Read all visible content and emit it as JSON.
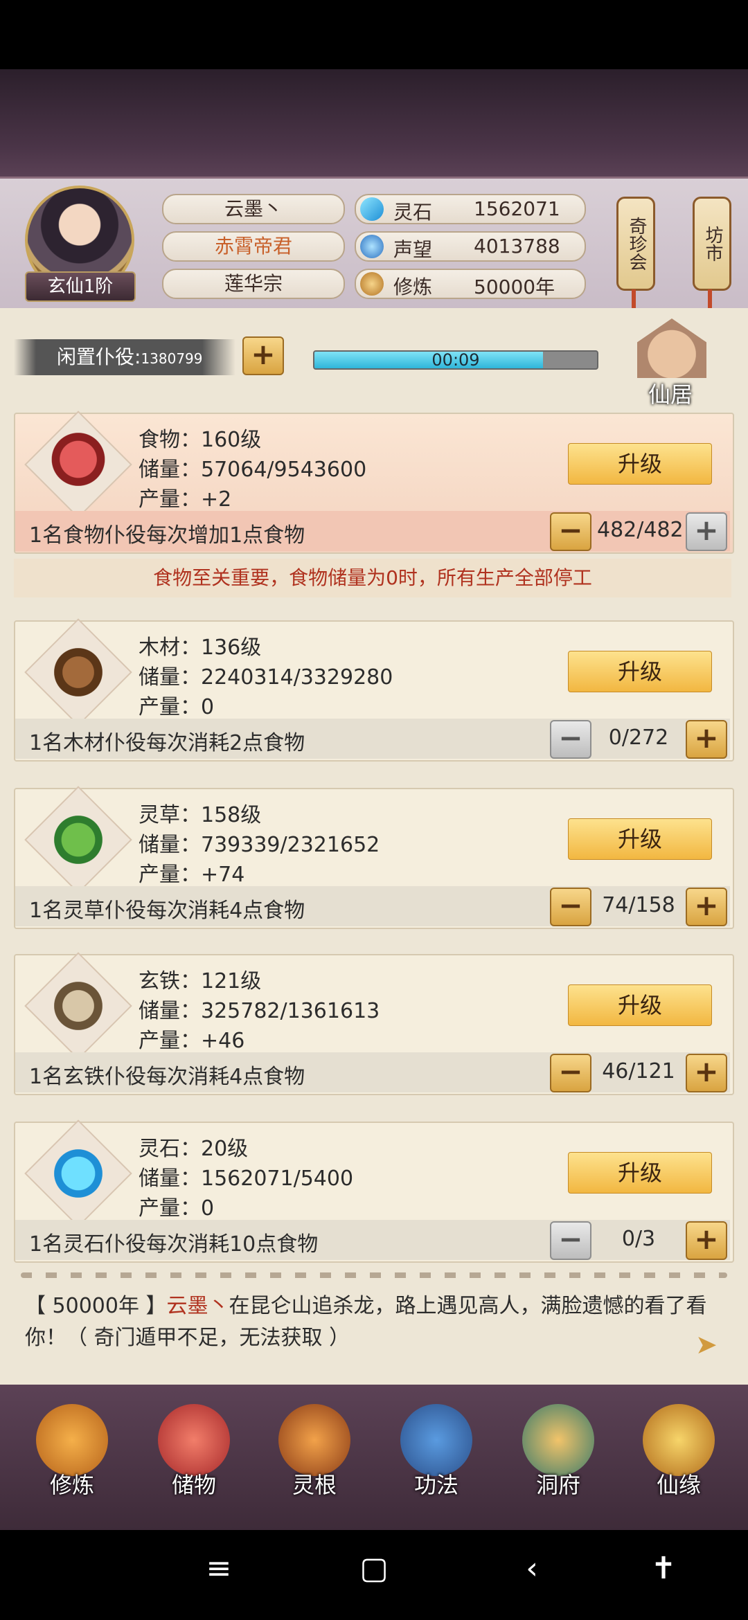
{
  "header": {
    "player_name": "云墨丶",
    "title": "赤霄帝君",
    "sect": "莲华宗",
    "rank": "玄仙1阶",
    "stats": [
      {
        "label": "灵石",
        "value": "1562071",
        "icon": "spirit-stone-icon",
        "color": "#34b7e8"
      },
      {
        "label": "声望",
        "value": "4013788",
        "icon": "reputation-icon",
        "color": "#3a8fd6"
      },
      {
        "label": "修炼",
        "value": "50000年",
        "icon": "cultivation-icon",
        "color": "#c28a2e"
      }
    ],
    "lanterns": [
      "奇珍会",
      "坊市"
    ]
  },
  "servants": {
    "label": "闲置仆役:",
    "count": "1380799",
    "timer": "00:09",
    "timer_progress": 0.81,
    "building_label": "仙居"
  },
  "resources": [
    {
      "name": "食物",
      "level": "食物：160级",
      "storage": "储量：57064/9543600",
      "output": "产量：+2",
      "note": "1名食物仆役每次增加1点食物",
      "assigned": "482/482",
      "upgrade": "升级",
      "highlight": true
    },
    {
      "name": "木材",
      "level": "木材：136级",
      "storage": "储量：2240314/3329280",
      "output": "产量：0",
      "note": "1名木材仆役每次消耗2点食物",
      "assigned": "0/272",
      "upgrade": "升级",
      "highlight": false
    },
    {
      "name": "灵草",
      "level": "灵草：158级",
      "storage": "储量：739339/2321652",
      "output": "产量：+74",
      "note": "1名灵草仆役每次消耗4点食物",
      "assigned": "74/158",
      "upgrade": "升级",
      "highlight": false
    },
    {
      "name": "玄铁",
      "level": "玄铁：121级",
      "storage": "储量：325782/1361613",
      "output": "产量：+46",
      "note": "1名玄铁仆役每次消耗4点食物",
      "assigned": "46/121",
      "upgrade": "升级",
      "highlight": false
    },
    {
      "name": "灵石",
      "level": "灵石：20级",
      "storage": "储量：1562071/5400",
      "output": "产量：0",
      "note": "1名灵石仆役每次消耗10点食物",
      "assigned": "0/3",
      "upgrade": "升级",
      "highlight": false
    }
  ],
  "warning": "食物至关重要，食物储量为0时，所有生产全部停工",
  "log": {
    "prefix": "【 50000年 】",
    "name": "云墨丶",
    "text": "在昆仑山追杀龙，路上遇见高人，满脸遗憾的看了看你！（ 奇门遁甲不足，无法获取 ）"
  },
  "nav": [
    {
      "label": "修炼",
      "icon": "cultivate-icon"
    },
    {
      "label": "储物",
      "icon": "storage-bag-icon"
    },
    {
      "label": "灵根",
      "icon": "spirit-root-icon"
    },
    {
      "label": "功法",
      "icon": "technique-book-icon"
    },
    {
      "label": "洞府",
      "icon": "cave-abode-icon"
    },
    {
      "label": "仙缘",
      "icon": "fate-gourd-icon"
    }
  ],
  "system_nav": [
    "≡",
    "▢",
    "‹",
    "✝"
  ]
}
